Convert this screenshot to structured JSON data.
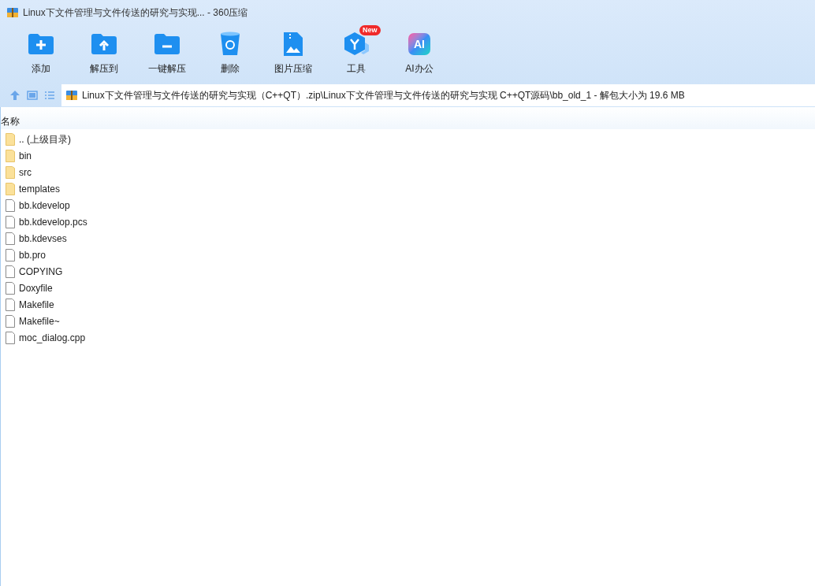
{
  "window": {
    "title": "Linux下文件管理与文件传送的研究与实现... - 360压缩"
  },
  "toolbar": [
    {
      "kind": "add",
      "label": "添加"
    },
    {
      "kind": "extract",
      "label": "解压到"
    },
    {
      "kind": "oneclick",
      "label": "一键解压"
    },
    {
      "kind": "delete",
      "label": "删除"
    },
    {
      "kind": "image",
      "label": "图片压缩"
    },
    {
      "kind": "tools",
      "label": "工具",
      "badge": "New"
    },
    {
      "kind": "ai",
      "label": "AI办公",
      "icon_text": "AI"
    }
  ],
  "address": {
    "path": "Linux下文件管理与文件传送的研究与实现（C++QT）.zip\\Linux下文件管理与文件传送的研究与实现 C++QT源码\\bb_old_1 - 解包大小为 19.6 MB"
  },
  "table": {
    "columns": [
      "名称"
    ],
    "rows": [
      {
        "kind": "folder",
        "name": ".. (上级目录)"
      },
      {
        "kind": "folder",
        "name": "bin"
      },
      {
        "kind": "folder",
        "name": "src"
      },
      {
        "kind": "folder",
        "name": "templates"
      },
      {
        "kind": "file",
        "name": "bb.kdevelop"
      },
      {
        "kind": "file",
        "name": "bb.kdevelop.pcs"
      },
      {
        "kind": "file",
        "name": "bb.kdevses"
      },
      {
        "kind": "file",
        "name": "bb.pro"
      },
      {
        "kind": "file",
        "name": "COPYING"
      },
      {
        "kind": "file",
        "name": "Doxyfile"
      },
      {
        "kind": "file",
        "name": "Makefile"
      },
      {
        "kind": "file",
        "name": "Makefile~"
      },
      {
        "kind": "file",
        "name": "moc_dialog.cpp"
      }
    ]
  }
}
